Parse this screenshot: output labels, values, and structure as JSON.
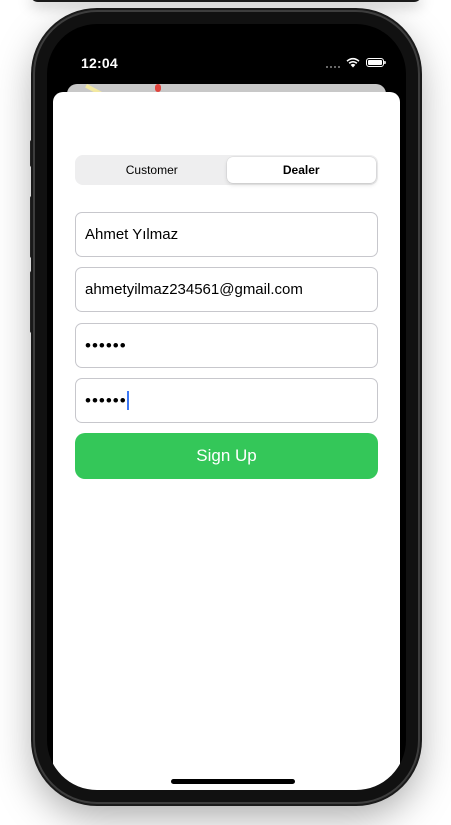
{
  "status_bar": {
    "time": "12:04",
    "icons": [
      "signal-dots-icon",
      "wifi-icon",
      "battery-icon"
    ]
  },
  "segmented_control": {
    "options": [
      {
        "label": "Customer",
        "selected": false
      },
      {
        "label": "Dealer",
        "selected": true
      }
    ]
  },
  "form": {
    "name_value": "Ahmet Yılmaz",
    "email_value": "ahmetyilmaz234561@gmail.com",
    "password_value": "••••••",
    "confirm_password_value": "••••••",
    "signup_label": "Sign Up"
  },
  "colors": {
    "accent_green": "#34c759",
    "caret_blue": "#3c78f5",
    "field_border": "#c7c7cc"
  }
}
